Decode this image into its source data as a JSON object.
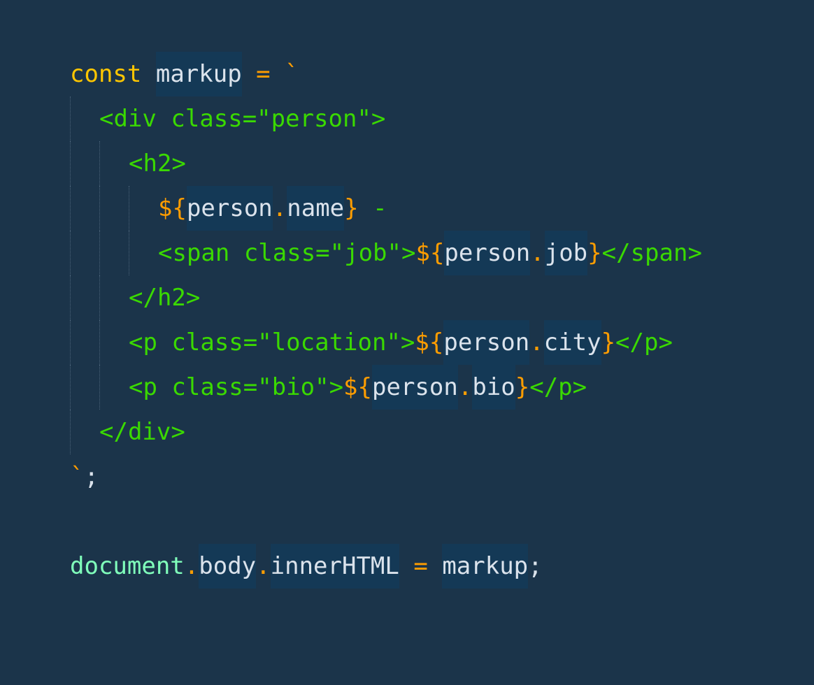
{
  "colors": {
    "background": "#1b344a",
    "keyword": "#ffc600",
    "operator": "#ff9d00",
    "identifier": "#dbe3ec",
    "markup": "#3ad900",
    "global": "#80ffbb",
    "highlight": "#143956",
    "guide": "#4a6278"
  },
  "code": {
    "lines": [
      {
        "indent": 0,
        "tokens": [
          {
            "text": "const",
            "type": "keyword"
          },
          {
            "text": " ",
            "type": "plain"
          },
          {
            "text": "markup",
            "type": "identifier",
            "hl": true
          },
          {
            "text": " ",
            "type": "plain"
          },
          {
            "text": "=",
            "type": "operator"
          },
          {
            "text": " ",
            "type": "plain"
          },
          {
            "text": "`",
            "type": "operator"
          }
        ]
      },
      {
        "indent": 1,
        "tokens": [
          {
            "text": "<div class=\"person\">",
            "type": "markup"
          }
        ]
      },
      {
        "indent": 2,
        "tokens": [
          {
            "text": "<h2>",
            "type": "markup"
          }
        ]
      },
      {
        "indent": 3,
        "tokens": [
          {
            "text": "${",
            "type": "operator"
          },
          {
            "text": "person",
            "type": "identifier",
            "hl": true
          },
          {
            "text": ".",
            "type": "operator"
          },
          {
            "text": "name",
            "type": "identifier",
            "hl": true
          },
          {
            "text": "}",
            "type": "operator"
          },
          {
            "text": " -",
            "type": "markup"
          }
        ]
      },
      {
        "indent": 3,
        "tokens": [
          {
            "text": "<span class=\"job\">",
            "type": "markup"
          },
          {
            "text": "${",
            "type": "operator"
          },
          {
            "text": "person",
            "type": "identifier",
            "hl": true
          },
          {
            "text": ".",
            "type": "operator"
          },
          {
            "text": "job",
            "type": "identifier",
            "hl": true
          },
          {
            "text": "}",
            "type": "operator"
          },
          {
            "text": "</span>",
            "type": "markup"
          }
        ]
      },
      {
        "indent": 2,
        "tokens": [
          {
            "text": "</h2>",
            "type": "markup"
          }
        ]
      },
      {
        "indent": 2,
        "tokens": [
          {
            "text": "<p class=\"location\">",
            "type": "markup"
          },
          {
            "text": "${",
            "type": "operator"
          },
          {
            "text": "person",
            "type": "identifier",
            "hl": true
          },
          {
            "text": ".",
            "type": "operator"
          },
          {
            "text": "city",
            "type": "identifier",
            "hl": true
          },
          {
            "text": "}",
            "type": "operator"
          },
          {
            "text": "</p>",
            "type": "markup"
          }
        ]
      },
      {
        "indent": 2,
        "tokens": [
          {
            "text": "<p class=\"bio\">",
            "type": "markup"
          },
          {
            "text": "${",
            "type": "operator"
          },
          {
            "text": "person",
            "type": "identifier",
            "hl": true
          },
          {
            "text": ".",
            "type": "operator"
          },
          {
            "text": "bio",
            "type": "identifier",
            "hl": true
          },
          {
            "text": "}",
            "type": "operator"
          },
          {
            "text": "</p>",
            "type": "markup"
          }
        ]
      },
      {
        "indent": 1,
        "tokens": [
          {
            "text": "</div>",
            "type": "markup"
          }
        ]
      },
      {
        "indent": 0,
        "tokens": [
          {
            "text": "`",
            "type": "operator"
          },
          {
            "text": ";",
            "type": "identifier"
          }
        ]
      },
      {
        "indent": 0,
        "tokens": []
      },
      {
        "indent": 0,
        "tokens": [
          {
            "text": "document",
            "type": "global"
          },
          {
            "text": ".",
            "type": "operator"
          },
          {
            "text": "body",
            "type": "identifier",
            "hl": true
          },
          {
            "text": ".",
            "type": "operator"
          },
          {
            "text": "innerHTML",
            "type": "identifier",
            "hl": true
          },
          {
            "text": " ",
            "type": "plain"
          },
          {
            "text": "=",
            "type": "operator"
          },
          {
            "text": " ",
            "type": "plain"
          },
          {
            "text": "markup",
            "type": "identifier",
            "hl": true
          },
          {
            "text": ";",
            "type": "identifier"
          }
        ]
      }
    ]
  }
}
